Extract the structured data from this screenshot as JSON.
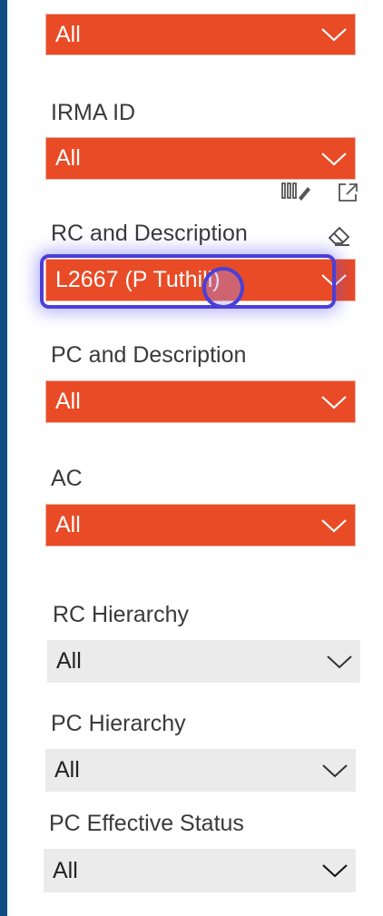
{
  "filters": {
    "top": {
      "value": "All"
    },
    "irma_id": {
      "label": "IRMA ID",
      "value": "All"
    },
    "rc_description": {
      "label": "RC and Description",
      "value": "L2667 (P Tuthill)"
    },
    "pc_description": {
      "label": "PC and Description",
      "value": "All"
    },
    "ac": {
      "label": "AC",
      "value": "All"
    },
    "rc_hierarchy": {
      "label": "RC Hierarchy",
      "value": "All"
    },
    "pc_hierarchy": {
      "label": "PC Hierarchy",
      "value": "All"
    },
    "pc_effective_status": {
      "label": "PC Effective Status",
      "value": "All"
    }
  },
  "icons": {
    "format": "format-painter-icon",
    "expand": "focus-mode-icon",
    "clear": "eraser-icon",
    "chevron": "chevron-down-icon"
  },
  "colors": {
    "accent": "#e84b26",
    "sidebar": "#0f4c81",
    "gray_box": "#ebebeb",
    "focus": "#4a3fd6"
  }
}
